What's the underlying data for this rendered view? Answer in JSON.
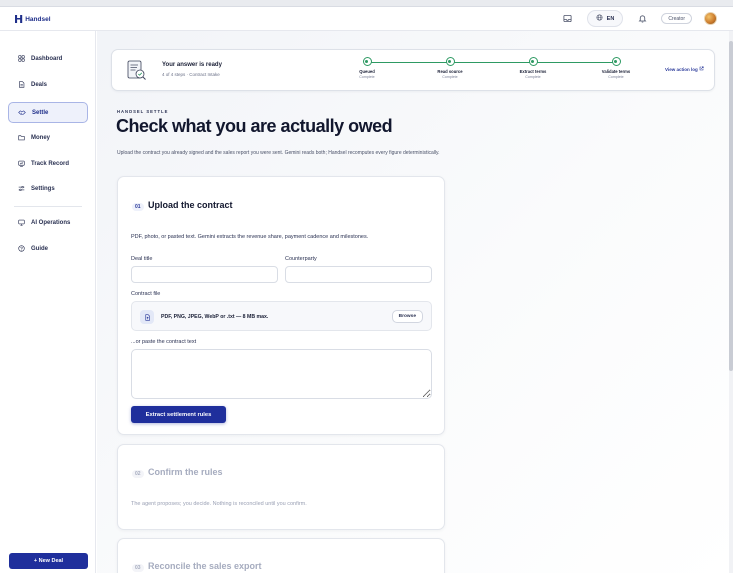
{
  "app": {
    "brand_mark": "H",
    "brand_name": "Handsel"
  },
  "topbar": {
    "language": "EN",
    "role": "Creator",
    "icons": [
      "inbox-icon",
      "globe-icon",
      "bell-icon"
    ]
  },
  "sidebar": {
    "items": [
      {
        "label": "Dashboard",
        "icon": "grid-icon",
        "active": false
      },
      {
        "label": "Deals",
        "icon": "document-icon",
        "active": false
      },
      {
        "label": "Settle",
        "icon": "handshake-icon",
        "active": true
      },
      {
        "label": "Money",
        "icon": "folder-icon",
        "active": false
      },
      {
        "label": "Track Record",
        "icon": "record-icon",
        "active": false
      },
      {
        "label": "Settings",
        "icon": "sliders-icon",
        "active": false
      },
      {
        "label": "AI Operations",
        "icon": "monitor-icon",
        "active": false
      },
      {
        "label": "Guide",
        "icon": "help-icon",
        "active": false
      }
    ],
    "new_deal_label": "+ New Deal"
  },
  "status": {
    "title": "Your answer is ready",
    "subtitle": "4 of 4 steps · Contract Intake",
    "steps": [
      {
        "label": "Queued",
        "state": "Complete"
      },
      {
        "label": "Read source",
        "state": "Complete"
      },
      {
        "label": "Extract terms",
        "state": "Complete"
      },
      {
        "label": "Validate terms",
        "state": "Complete"
      }
    ],
    "action_log_label": "View action log",
    "step_color": "#2e9a63"
  },
  "page": {
    "eyebrow": "HANDSEL SETTLE",
    "title": "Check what you are actually owed",
    "description": "Upload the contract you already signed and the sales report you were sent. Gemini reads both; Handsel recomputes every figure deterministically."
  },
  "section1": {
    "number": "01",
    "title": "Upload the contract",
    "description": "PDF, photo, or pasted text. Gemini extracts the revenue share, payment cadence and milestones.",
    "deal_title_label": "Deal title",
    "deal_title_value": "",
    "counterparty_label": "Counterparty",
    "counterparty_value": "",
    "contract_file_label": "Contract file",
    "dropzone_text": "PDF, PNG, JPEG, WebP or .txt — 8 MB max.",
    "browse_label": "Browse",
    "paste_label": "...or paste the contract text",
    "paste_value": "",
    "submit_label": "Extract settlement rules"
  },
  "section2": {
    "number": "02",
    "title": "Confirm the rules",
    "description": "The agent proposes; you decide. Nothing is reconciled until you confirm."
  },
  "section3": {
    "number": "03",
    "title": "Reconcile the sales export"
  },
  "colors": {
    "accent": "#1f2f9c",
    "success": "#2e9a63"
  }
}
